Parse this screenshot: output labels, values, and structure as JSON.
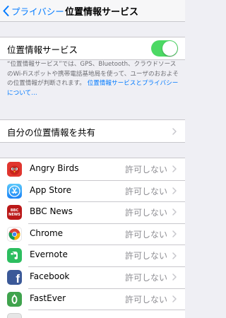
{
  "nav": {
    "back_label": "プライバシー",
    "title": "位置情報サービス"
  },
  "location_services": {
    "label": "位置情報サービス",
    "enabled": true
  },
  "footnote": {
    "text": "“位置情報サービス”では、GPS、Bluetooth、クラウドソースのWi-Fiスポットや携帯電話基地局を使って、ユーザのおおよその位置情報が判断されます。",
    "link": "位置情報サービスとプライバシーについて…"
  },
  "share_location": {
    "label": "自分の位置情報を共有"
  },
  "apps": [
    {
      "name": "Angry Birds",
      "status": "許可しない",
      "icon": "angry-birds-icon"
    },
    {
      "name": "App Store",
      "status": "許可しない",
      "icon": "app-store-icon"
    },
    {
      "name": "BBC News",
      "status": "許可しない",
      "icon": "bbc-news-icon",
      "icon_text": "BBC\nNEWS"
    },
    {
      "name": "Chrome",
      "status": "許可しない",
      "icon": "chrome-icon"
    },
    {
      "name": "Evernote",
      "status": "許可しない",
      "icon": "evernote-icon"
    },
    {
      "name": "Facebook",
      "status": "許可しない",
      "icon": "facebook-icon",
      "icon_text": "f"
    },
    {
      "name": "FastEver",
      "status": "許可しない",
      "icon": "fastever-icon"
    },
    {
      "name": "",
      "status": "",
      "icon": "partial-app-icon"
    }
  ],
  "colors": {
    "accent": "#007aff",
    "toggle_on": "#4cd964",
    "background": "#efeff4",
    "secondary_text": "#8e8e93"
  }
}
